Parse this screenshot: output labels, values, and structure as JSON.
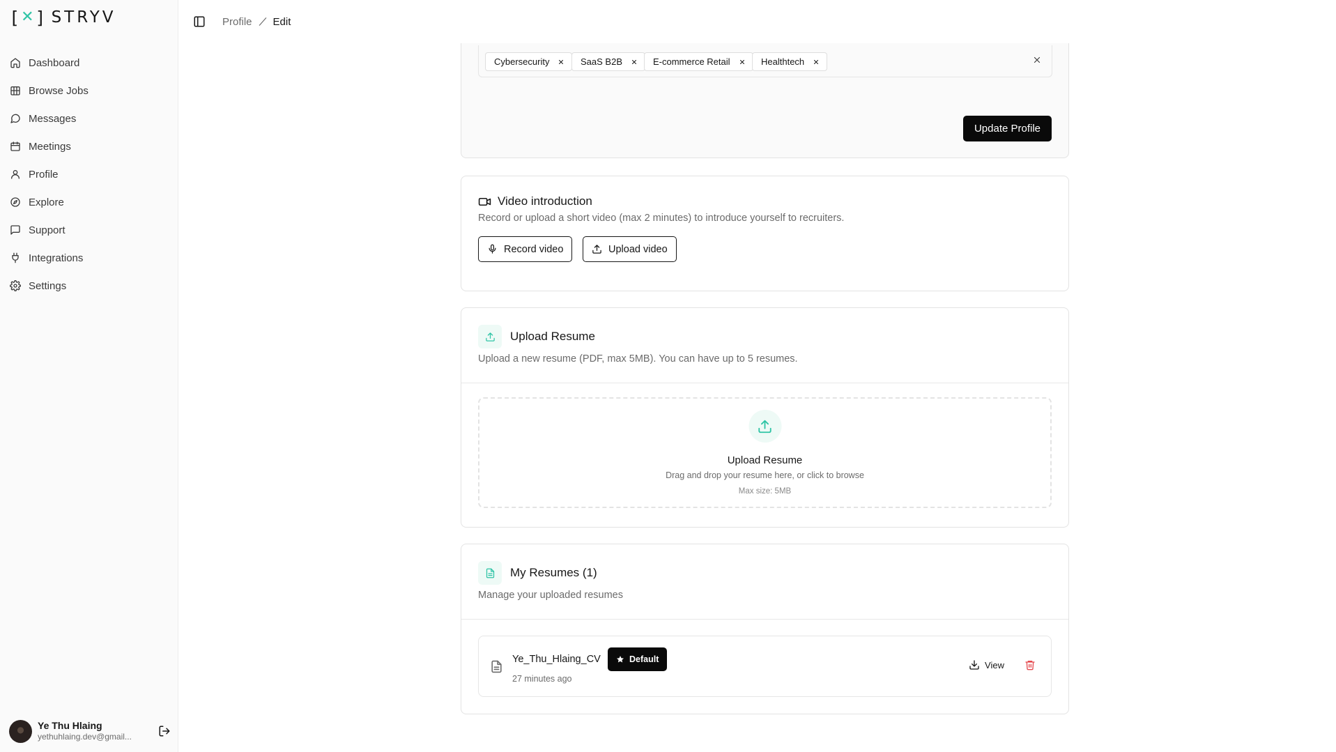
{
  "brand": {
    "name": "STRYV",
    "accent": "#2ec4a5"
  },
  "sidebar": {
    "items": [
      {
        "label": "Dashboard",
        "icon": "home-icon"
      },
      {
        "label": "Browse Jobs",
        "icon": "building-icon"
      },
      {
        "label": "Messages",
        "icon": "message-circle-icon"
      },
      {
        "label": "Meetings",
        "icon": "calendar-icon"
      },
      {
        "label": "Profile",
        "icon": "user-icon"
      },
      {
        "label": "Explore",
        "icon": "compass-icon"
      },
      {
        "label": "Support",
        "icon": "message-square-icon"
      },
      {
        "label": "Integrations",
        "icon": "plug-icon"
      },
      {
        "label": "Settings",
        "icon": "gear-icon"
      }
    ],
    "user": {
      "name": "Ye Thu Hlaing",
      "email": "yethuhlaing.dev@gmail..."
    }
  },
  "header": {
    "breadcrumb": {
      "parent": "Profile",
      "current": "Edit"
    }
  },
  "profile_form": {
    "industry_tags": [
      "Cybersecurity",
      "SaaS B2B",
      "E-commerce Retail",
      "Healthtech"
    ],
    "update_label": "Update Profile"
  },
  "video": {
    "title": "Video introduction",
    "description": "Record or upload a short video (max 2 minutes) to introduce yourself to recruiters.",
    "record_label": "Record video",
    "upload_label": "Upload video"
  },
  "upload_resume": {
    "title": "Upload Resume",
    "description": "Upload a new resume (PDF, max 5MB). You can have up to 5 resumes.",
    "dropzone_title": "Upload Resume",
    "dropzone_desc": "Drag and drop your resume here, or click to browse",
    "dropzone_max": "Max size: 5MB"
  },
  "my_resumes": {
    "title": "My Resumes (1)",
    "description": "Manage your uploaded resumes",
    "items": [
      {
        "name": "Ye_Thu_Hlaing_CV",
        "badge": "Default",
        "time": "27 minutes ago",
        "view_label": "View"
      }
    ]
  }
}
